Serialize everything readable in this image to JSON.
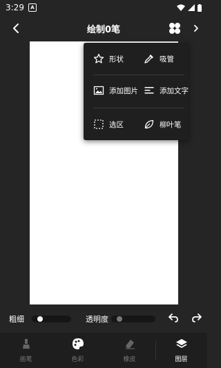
{
  "status_bar": {
    "time": "3:29",
    "notification_badge": "A"
  },
  "header": {
    "title": "绘制0笔"
  },
  "popup_menu": {
    "items": [
      {
        "label": "形状",
        "icon": "star-icon"
      },
      {
        "label": "吸管",
        "icon": "eyedropper-icon"
      },
      {
        "label": "添加图片",
        "icon": "image-icon"
      },
      {
        "label": "添加文字",
        "icon": "text-lines-icon"
      },
      {
        "label": "选区",
        "icon": "selection-icon"
      },
      {
        "label": "柳叶笔",
        "icon": "leaf-icon"
      }
    ]
  },
  "controls": {
    "thickness_label": "粗细",
    "opacity_label": "透明度",
    "thickness_level": 0.0,
    "opacity_level": 0.0
  },
  "bottom_nav": {
    "items": [
      {
        "label": "画笔",
        "icon": "brush-icon",
        "active": false
      },
      {
        "label": "色彩",
        "icon": "palette-icon",
        "active": false
      },
      {
        "label": "橡皮",
        "icon": "eraser-icon",
        "active": false
      },
      {
        "label": "图层",
        "icon": "layers-icon",
        "active": true
      }
    ]
  },
  "colors": {
    "background": "#252525",
    "canvas": "#ffffff",
    "popup": "#1f1f1f"
  }
}
